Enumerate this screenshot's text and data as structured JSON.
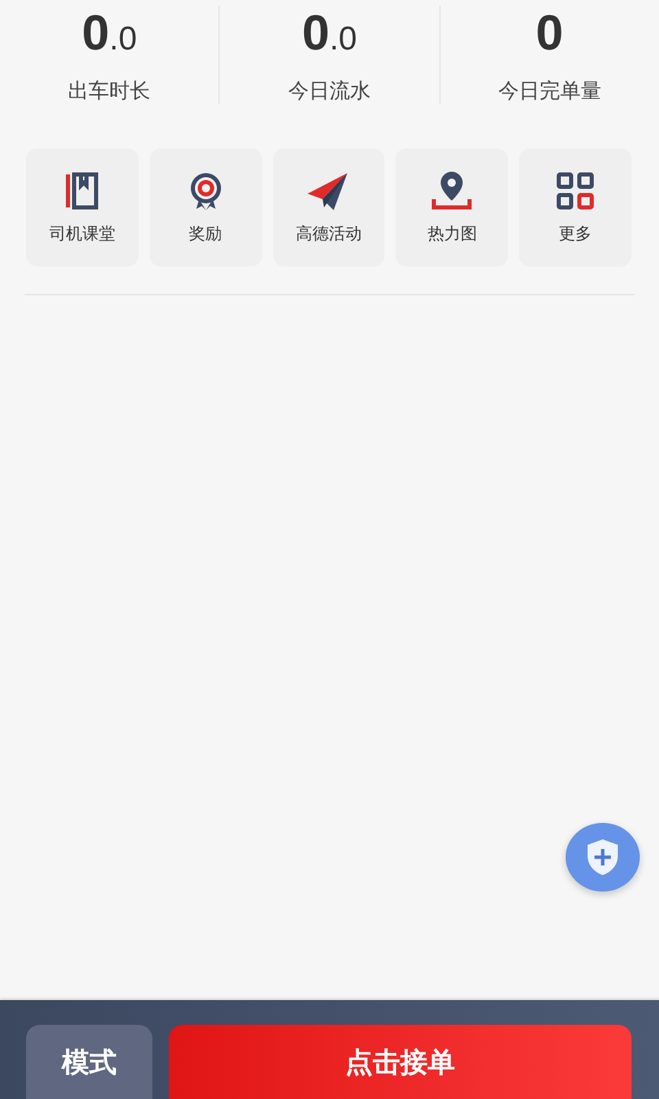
{
  "stats": [
    {
      "value": "0.0",
      "label": "出车时长"
    },
    {
      "value": "0.0",
      "label": "今日流水"
    },
    {
      "value": "0",
      "label": "今日完单量"
    }
  ],
  "shortcuts": [
    {
      "kind": "book",
      "label": "司机课堂"
    },
    {
      "kind": "medal",
      "label": "奖励"
    },
    {
      "kind": "plane",
      "label": "高德活动"
    },
    {
      "kind": "pin",
      "label": "热力图"
    },
    {
      "kind": "grid",
      "label": "更多"
    }
  ],
  "bottom_bar": {
    "mode_button": "模式",
    "accept_button": "点击接单"
  }
}
